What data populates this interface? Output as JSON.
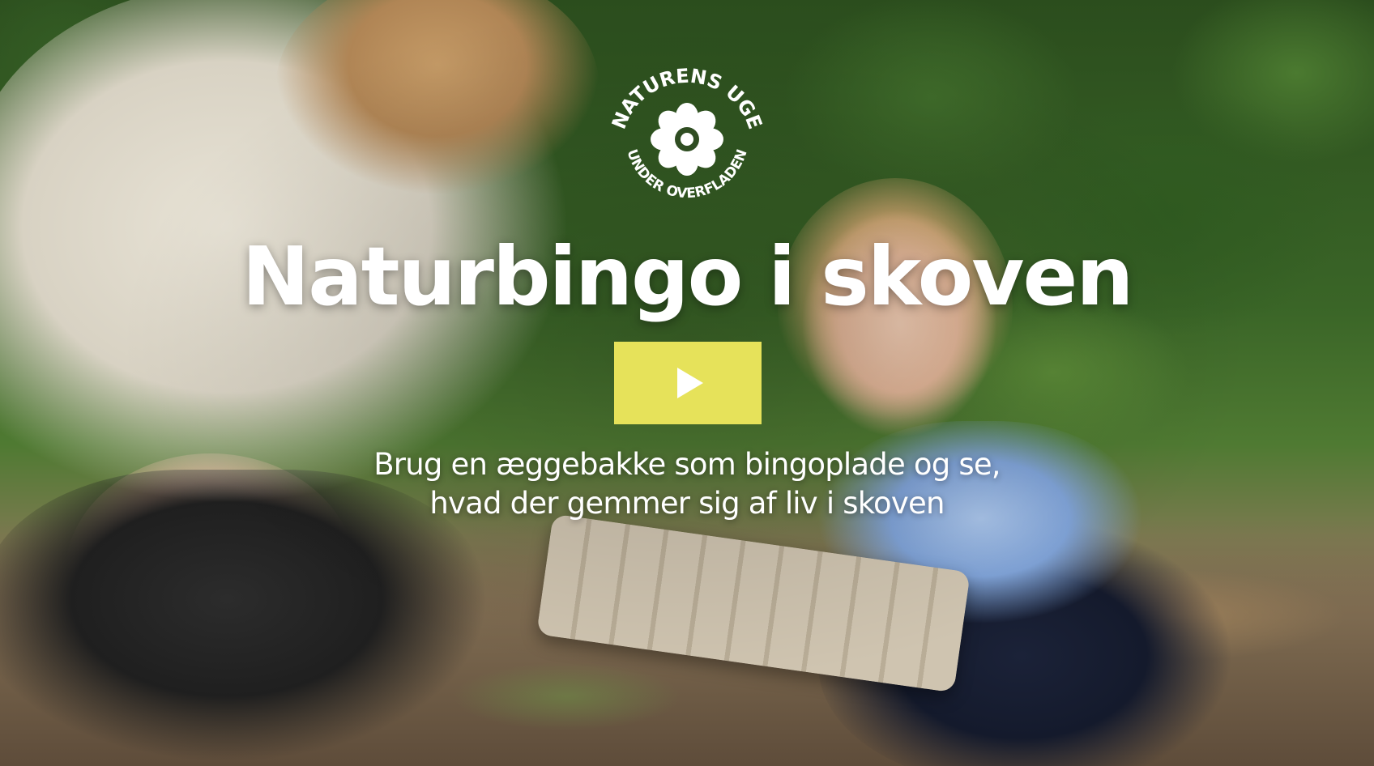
{
  "video": {
    "title": "Naturbingo i skoven",
    "subtitle_lines": [
      "Brug en æggebakke som bingoplade og se,",
      "hvad der gemmer sig af liv i skoven"
    ],
    "play_button_color": "#e6e25a",
    "play_icon": "play-icon"
  },
  "logo": {
    "top_text": "NATURENS UGE",
    "bottom_text": "UNDER OVERFLADEN",
    "icon": "flower-icon"
  }
}
